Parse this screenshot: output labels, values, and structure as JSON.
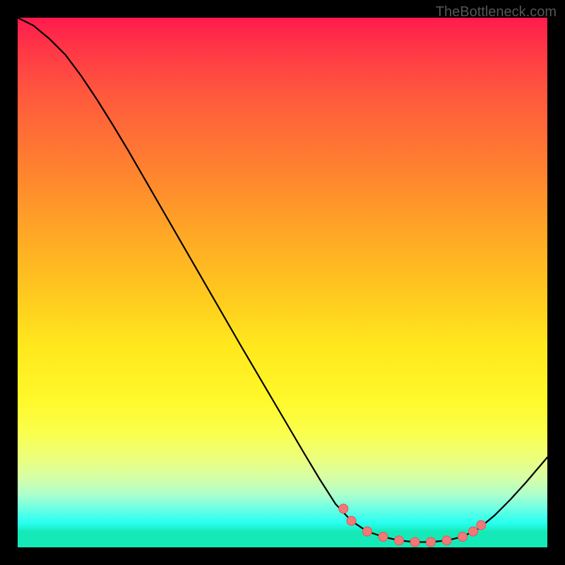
{
  "watermark": "TheBottleneck.com",
  "chart_data": {
    "type": "line",
    "title": "",
    "xlabel": "",
    "ylabel": "",
    "xlim": [
      0,
      100
    ],
    "ylim": [
      0,
      100
    ],
    "x": [
      0,
      3,
      6,
      9,
      12,
      15,
      18,
      21,
      24,
      27,
      30,
      33,
      36,
      39,
      42,
      45,
      48,
      51,
      54,
      57,
      60,
      63,
      66,
      69,
      72,
      75,
      78,
      81,
      84,
      87,
      90,
      93,
      96,
      100
    ],
    "y": [
      100,
      98.5,
      96,
      93,
      89,
      84.5,
      79.7,
      74.7,
      69.5,
      64.3,
      59.1,
      53.9,
      48.7,
      43.5,
      38.3,
      33.2,
      28.1,
      23.0,
      17.9,
      12.9,
      8.2,
      5.0,
      3.0,
      2.0,
      1.3,
      1.0,
      1.0,
      1.3,
      2.0,
      3.5,
      6.0,
      9.0,
      12.3,
      17.0
    ],
    "marker_points": {
      "x": [
        61.5,
        63,
        66,
        69,
        72,
        75,
        78,
        81,
        84,
        86,
        87.5
      ],
      "y": [
        7.3,
        5.0,
        3.0,
        2.0,
        1.3,
        1.0,
        1.0,
        1.3,
        2.0,
        3.0,
        4.2
      ]
    },
    "gradient_mapping": "y-value maps to background hue (high=red, low=green)"
  }
}
